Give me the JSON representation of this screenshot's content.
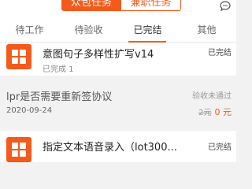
{
  "header": {
    "segments": [
      "众包任务",
      "兼职任务"
    ],
    "chat_icon": "chat-icon"
  },
  "tabs": [
    "待工作",
    "待验收",
    "已完结",
    "其他"
  ],
  "active_tab": 2,
  "accent_color": "#f45a1c",
  "tasks": [
    {
      "title": "意图句子多样性扩写v14",
      "status": "已完结",
      "sub": "已完成 1"
    },
    {
      "title": "lpr是否需要重新签协议",
      "status": "验收未通过",
      "date": "2020-09-24",
      "old_price": "2元",
      "new_price": "0 元"
    },
    {
      "title": "指定文本语音录入（lot300...",
      "status": "已完结"
    }
  ]
}
